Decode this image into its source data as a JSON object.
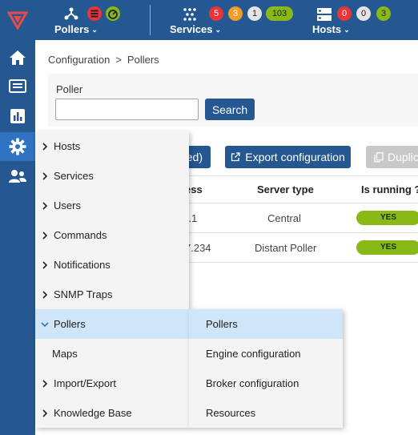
{
  "topbar": {
    "pollers": {
      "label": "Pollers",
      "badges": []
    },
    "services": {
      "label": "Services",
      "badges": [
        "5",
        "3",
        "1",
        "103"
      ]
    },
    "hosts": {
      "label": "Hosts",
      "badges": [
        "0",
        "0",
        "3"
      ]
    }
  },
  "breadcrumb": {
    "item1": "Configuration",
    "separator": ">",
    "item2": "Pollers"
  },
  "filter": {
    "label": "Poller",
    "value": "",
    "search_button": "Search"
  },
  "actions": {
    "apply_partial": "ed)",
    "export": "Export configuration",
    "duplicate": "Duplic"
  },
  "table": {
    "headers": {
      "address": "ess",
      "server_type": "Server type",
      "is_running": "Is running ?"
    },
    "rows": [
      {
        "address": ").1",
        "server_type": "Central",
        "running": "YES"
      },
      {
        "address": "7.234",
        "server_type": "Distant Poller",
        "running": "YES"
      }
    ]
  },
  "menu": {
    "items": [
      {
        "label": "Hosts"
      },
      {
        "label": "Services"
      },
      {
        "label": "Users"
      },
      {
        "label": "Commands"
      },
      {
        "label": "Notifications"
      },
      {
        "label": "SNMP Traps"
      },
      {
        "label": "Pollers"
      },
      {
        "label": "Maps"
      },
      {
        "label": "Import/Export"
      },
      {
        "label": "Knowledge Base"
      }
    ],
    "submenu": [
      {
        "label": "Pollers"
      },
      {
        "label": "Engine configuration"
      },
      {
        "label": "Broker configuration"
      },
      {
        "label": "Resources"
      }
    ]
  },
  "colors": {
    "brand_blue": "#255891",
    "active_blue": "#2f73c2",
    "status_red": "#ec3338",
    "status_orange": "#f39c2a",
    "status_green": "#88b917",
    "highlight": "#cfe6f9"
  }
}
